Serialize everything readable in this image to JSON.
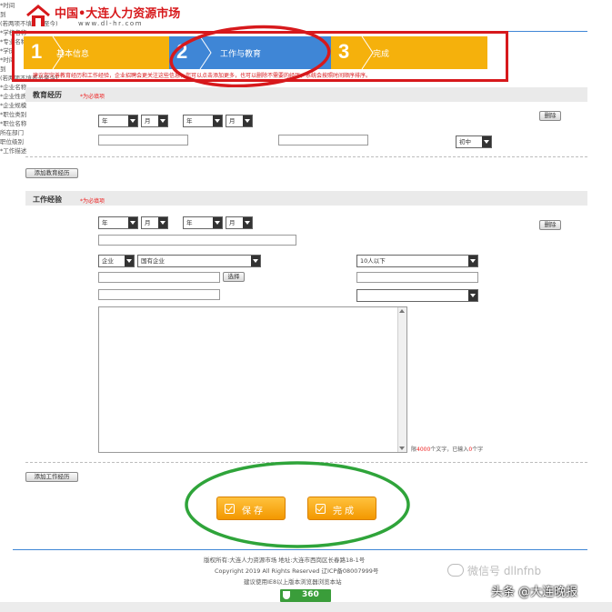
{
  "header": {
    "logo_title": "中国•大连人力资源市场",
    "logo_url": "www.dl-hr.com"
  },
  "steps": [
    {
      "num": "1",
      "label": "基本信息"
    },
    {
      "num": "2",
      "label": "工作与教育"
    },
    {
      "num": "3",
      "label": "完成"
    }
  ],
  "hint": "建议您完善教育经历和工作经验，企业招聘会更关注这些信息，您可以点击添加更多，也可以删除不需要的经历，系统会按照时间顺序排序。",
  "education": {
    "title": "教育经历",
    "required_note": "*为必填项",
    "time_label": "*时间",
    "year": "年",
    "month": "月",
    "to": "到",
    "note": "(若两项不填表示至今)",
    "delete": "删除",
    "school_label": "*学校名称",
    "major_label": "*专业名称",
    "degree_label": "*学历",
    "degree_value": "初中",
    "add": "添加教育经历"
  },
  "work": {
    "title": "工作经验",
    "required_note": "*为必填项",
    "time_label": "*时间",
    "year": "年",
    "month": "月",
    "to": "到",
    "note": "(若两项不填表示至今)",
    "delete": "删除",
    "company_label": "*企业名称",
    "nature_label": "*企业性质",
    "nature_value1": "企业",
    "nature_value2": "国有企业",
    "scale_label": "*企业规模",
    "scale_value": "10人以下",
    "category_label": "*职位类别",
    "choose": "选择",
    "position_label": "*职位名称",
    "dept_label": "所在部门",
    "level_label": "职位级别",
    "desc_label": "*工作描述",
    "counter_prefix": "限",
    "counter_max": "4000",
    "counter_mid": "个文字，已输入",
    "counter_num": "0",
    "counter_suffix": "个字",
    "add": "添加工作经历"
  },
  "buttons": {
    "save": "保存",
    "finish": "完成"
  },
  "footer": {
    "line1": "版权所有:大连人力资源市场   地址:大连市西岗区长春路18-1号",
    "line2": "Copyright 2019 All Rights Reserved  辽ICP备08007999号",
    "line3": "建议使用IE8以上版本浏览器浏览本站",
    "badge": "360"
  },
  "watermark": "头条 @大连晚报",
  "watermark2": "微信号 dllnfnb",
  "colors": {
    "step_orange": "#f5b10c",
    "step_blue": "#3f86d6",
    "highlight_red": "#d7191c",
    "highlight_green": "#2fa43a"
  }
}
